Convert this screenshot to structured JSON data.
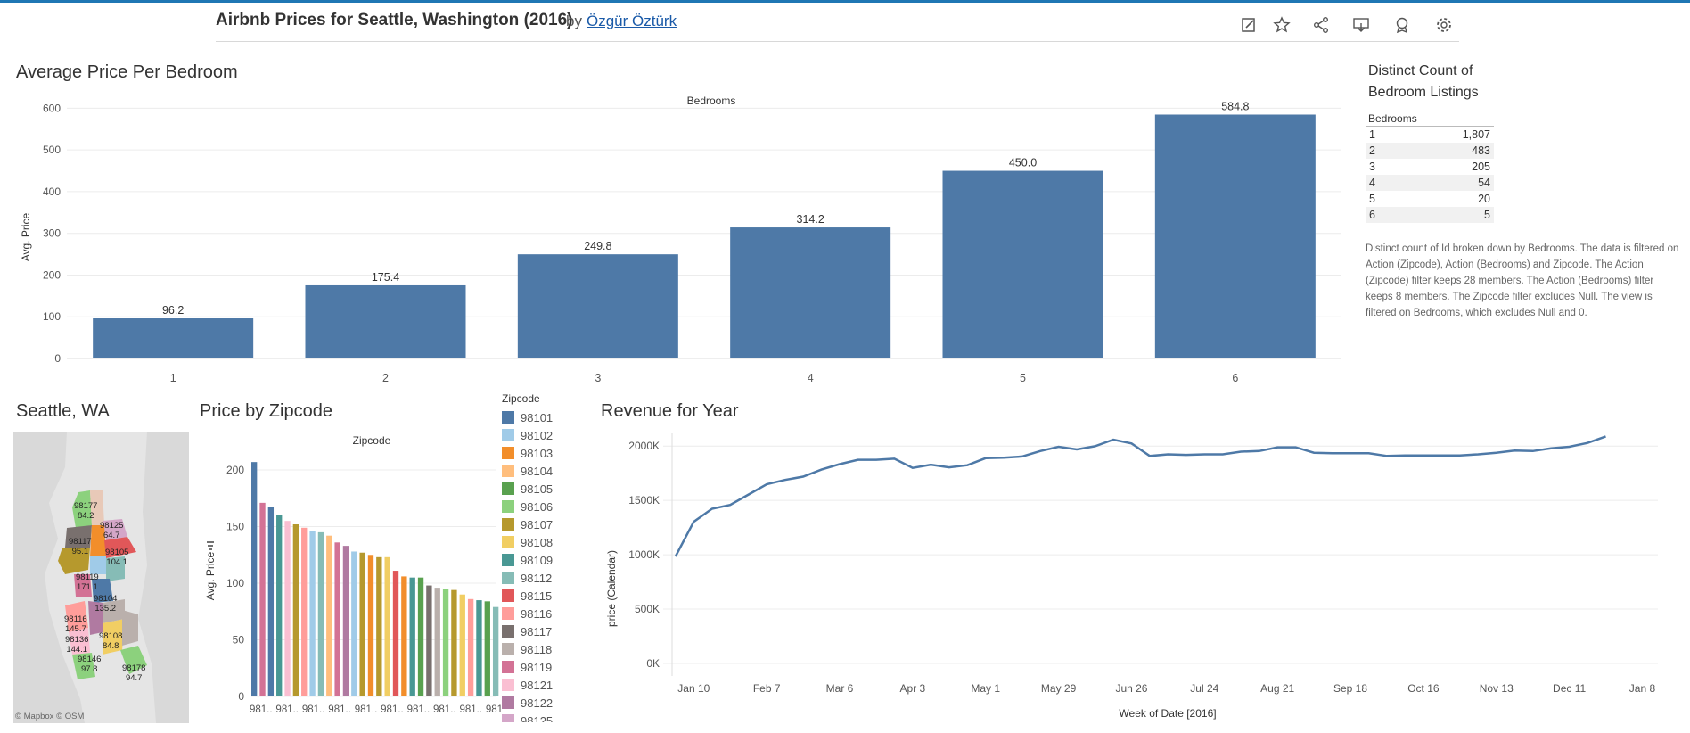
{
  "header": {
    "title": "Airbnb Prices for Seattle, Washington (2016)",
    "by": "by",
    "author": "Özgür Öztürk"
  },
  "toolbar": {
    "icons": [
      "edit-icon",
      "star-icon",
      "share-icon",
      "download-icon",
      "badge-icon",
      "gear-icon"
    ]
  },
  "bedroom_chart": {
    "section_title": "Average Price Per Bedroom",
    "header": "Bedrooms",
    "ylabel": "Avg. Price",
    "yticks": [
      "600",
      "500",
      "400",
      "300",
      "200",
      "100",
      "0"
    ]
  },
  "count_table": {
    "title_line1": "Distinct Count of",
    "title_line2": "Bedroom Listings",
    "header": "Bedrooms",
    "rows": [
      {
        "bedrooms": "1",
        "count": "1,807"
      },
      {
        "bedrooms": "2",
        "count": "483"
      },
      {
        "bedrooms": "3",
        "count": "205"
      },
      {
        "bedrooms": "4",
        "count": "54"
      },
      {
        "bedrooms": "5",
        "count": "20"
      },
      {
        "bedrooms": "6",
        "count": "5"
      }
    ],
    "note": "Distinct count of Id broken down by Bedrooms. The data is filtered on Action (Zipcode), Action (Bedrooms) and Zipcode. The Action (Zipcode) filter keeps 28 members. The Action (Bedrooms) filter keeps 8 members. The Zipcode filter excludes Null. The view is filtered on Bedrooms, which excludes Null and 0."
  },
  "map": {
    "section_title": "Seattle, WA",
    "labels": [
      {
        "zip": "98177",
        "value": "84.2"
      },
      {
        "zip": "98125",
        "value": "64.7"
      },
      {
        "zip": "98117",
        "value": "95.1"
      },
      {
        "zip": "98105",
        "value": "104.1"
      },
      {
        "zip": "98119",
        "value": "171.1"
      },
      {
        "zip": "98104",
        "value": "135.2"
      },
      {
        "zip": "98116",
        "value": "145.7"
      },
      {
        "zip": "98136",
        "value": "144.1"
      },
      {
        "zip": "98108",
        "value": "84.8"
      },
      {
        "zip": "98146",
        "value": "97.8"
      },
      {
        "zip": "98178",
        "value": "94.7"
      }
    ],
    "attribution": "© Mapbox  © OSM"
  },
  "zipcode_chart": {
    "section_title": "Price by Zipcode",
    "header": "Zipcode",
    "ylabel": "Avg. Price",
    "yticks": [
      "200",
      "150",
      "100",
      "50",
      "0"
    ],
    "xticklabels": [
      "981..",
      "981..",
      "981..",
      "981..",
      "981..",
      "981..",
      "981..",
      "981..",
      "981..",
      "9813:"
    ]
  },
  "legend": {
    "title": "Zipcode",
    "items": [
      {
        "zip": "98101",
        "color": "#4e79a7"
      },
      {
        "zip": "98102",
        "color": "#a0cbe8"
      },
      {
        "zip": "98103",
        "color": "#f28e2b"
      },
      {
        "zip": "98104",
        "color": "#ffbe7d"
      },
      {
        "zip": "98105",
        "color": "#59a14f"
      },
      {
        "zip": "98106",
        "color": "#8cd17d"
      },
      {
        "zip": "98107",
        "color": "#b6992d"
      },
      {
        "zip": "98108",
        "color": "#f1ce63"
      },
      {
        "zip": "98109",
        "color": "#499894"
      },
      {
        "zip": "98112",
        "color": "#86bcb6"
      },
      {
        "zip": "98115",
        "color": "#e15759"
      },
      {
        "zip": "98116",
        "color": "#ff9d9a"
      },
      {
        "zip": "98117",
        "color": "#79706e"
      },
      {
        "zip": "98118",
        "color": "#bab0ac"
      },
      {
        "zip": "98119",
        "color": "#d37295"
      },
      {
        "zip": "98121",
        "color": "#fabfd2"
      },
      {
        "zip": "98122",
        "color": "#b07aa1"
      },
      {
        "zip": "98125",
        "color": "#d4a6c8"
      }
    ]
  },
  "revenue_chart": {
    "section_title": "Revenue for Year",
    "ylabel": "price (Calendar)",
    "xlabel": "Week of Date [2016]",
    "yticks": [
      "2000K",
      "1500K",
      "1000K",
      "500K",
      "0K"
    ],
    "xticks": [
      "Jan 10",
      "Feb 7",
      "Mar 6",
      "Apr 3",
      "May 1",
      "May 29",
      "Jun 26",
      "Jul 24",
      "Aug 21",
      "Sep 18",
      "Oct 16",
      "Nov 13",
      "Dec 11",
      "Jan 8"
    ]
  },
  "chart_data": [
    {
      "type": "bar",
      "title": "Average Price Per Bedroom",
      "xlabel": "Bedrooms",
      "ylabel": "Avg. Price",
      "categories": [
        "1",
        "2",
        "3",
        "4",
        "5",
        "6"
      ],
      "values": [
        96.2,
        175.4,
        249.8,
        314.2,
        450.0,
        584.8
      ],
      "labels": [
        "96.2",
        "175.4",
        "249.8",
        "314.2",
        "450.0",
        "584.8"
      ],
      "ylim": [
        0,
        650
      ],
      "color": "#4e79a7",
      "grid": true
    },
    {
      "type": "bar",
      "title": "Price by Zipcode",
      "xlabel": "Zipcode",
      "ylabel": "Avg. Price",
      "values": [
        207,
        171,
        167,
        160,
        155,
        152,
        149,
        146,
        145,
        142,
        136,
        133,
        128,
        127,
        125,
        123,
        123,
        111,
        106,
        105,
        105,
        98,
        96,
        95,
        94,
        90,
        86,
        85,
        84,
        79,
        72,
        65
      ],
      "colors": [
        "#4e79a7",
        "#d37295",
        "#4e79a7",
        "#499894",
        "#fabfd2",
        "#b6992d",
        "#ff9d9a",
        "#a0cbe8",
        "#86bcb6",
        "#ffbe7d",
        "#d37295",
        "#b07aa1",
        "#a0cbe8",
        "#b6992d",
        "#f28e2b",
        "#b6992d",
        "#f1ce63",
        "#e15759",
        "#f28e2b",
        "#499894",
        "#59a14f",
        "#79706e",
        "#bab0ac",
        "#8cd17d",
        "#b6992d",
        "#f1ce63",
        "#ff9d9a",
        "#499894",
        "#59a14f",
        "#86bcb6",
        "#b07aa1",
        "#fabfd2"
      ],
      "ylim": [
        0,
        215
      ],
      "grid": true
    },
    {
      "type": "line",
      "title": "Revenue for Year",
      "xlabel": "Week of Date [2016]",
      "ylabel": "price (Calendar)",
      "x": [
        "2016-01-03",
        "2016-01-10",
        "2016-01-17",
        "2016-01-24",
        "2016-01-31",
        "2016-02-07",
        "2016-02-14",
        "2016-02-21",
        "2016-02-28",
        "2016-03-06",
        "2016-03-13",
        "2016-03-20",
        "2016-03-27",
        "2016-04-03",
        "2016-04-10",
        "2016-04-17",
        "2016-04-24",
        "2016-05-01",
        "2016-05-08",
        "2016-05-15",
        "2016-05-22",
        "2016-05-29",
        "2016-06-05",
        "2016-06-12",
        "2016-06-19",
        "2016-06-26",
        "2016-07-03",
        "2016-07-10",
        "2016-07-17",
        "2016-07-24",
        "2016-07-31",
        "2016-08-07",
        "2016-08-14",
        "2016-08-21",
        "2016-08-28",
        "2016-09-04",
        "2016-09-11",
        "2016-09-18",
        "2016-09-25",
        "2016-10-02",
        "2016-10-09",
        "2016-10-16",
        "2016-10-23",
        "2016-10-30",
        "2016-11-06",
        "2016-11-13",
        "2016-11-20",
        "2016-11-27",
        "2016-12-04",
        "2016-12-11",
        "2016-12-18",
        "2016-12-25"
      ],
      "y": [
        1000,
        1320,
        1440,
        1475,
        1570,
        1665,
        1705,
        1735,
        1800,
        1850,
        1890,
        1890,
        1900,
        1815,
        1845,
        1820,
        1840,
        1905,
        1910,
        1920,
        1970,
        2010,
        1985,
        2015,
        2075,
        2040,
        1925,
        1940,
        1935,
        1940,
        1940,
        1965,
        1970,
        2005,
        2005,
        1955,
        1950,
        1950,
        1950,
        1925,
        1930,
        1930,
        1930,
        1930,
        1940,
        1955,
        1975,
        1970,
        1995,
        2010,
        2045,
        2105
      ],
      "y_unit": "K",
      "ylim": [
        0,
        2100
      ],
      "grid": true
    }
  ]
}
